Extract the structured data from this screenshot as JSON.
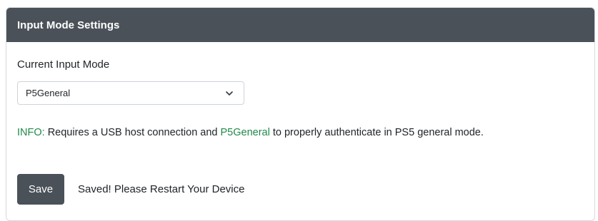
{
  "header": {
    "title": "Input Mode Settings"
  },
  "form": {
    "label": "Current Input Mode",
    "selected_value": "P5General",
    "dropdown_icon": "chevron-down-icon",
    "info": {
      "prefix": "INFO:",
      "text1": " Requires a USB host connection and ",
      "highlight": "P5General",
      "text2": " to properly authenticate in PS5 general mode."
    },
    "save_label": "Save",
    "status_text": "Saved! Please Restart Your Device"
  },
  "colors": {
    "header_bg": "#4a5158",
    "accent_green": "#20894a",
    "button_bg": "#4a5158"
  }
}
